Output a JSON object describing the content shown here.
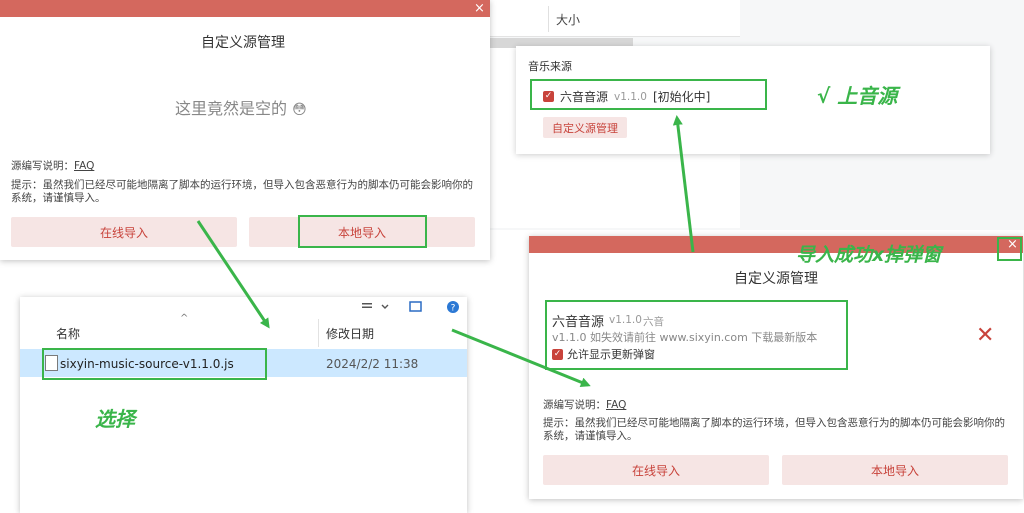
{
  "background": {
    "size_column": "大小"
  },
  "dialog1": {
    "title": "自定义源管理",
    "empty_text": "这里竟然是空的",
    "empty_emoji": "😳",
    "author_label": "源编写说明：",
    "faq": "FAQ",
    "hint": "提示：虽然我们已经尽可能地隔离了脚本的运行环境，但导入包含恶意行为的脚本仍可能会影响你的系统，请谨慎导入。",
    "online_import": "在线导入",
    "local_import": "本地导入",
    "close": "×"
  },
  "source_panel": {
    "label": "音乐来源",
    "source_name": "六音音源",
    "source_version": "v1.1.0",
    "source_status": "[初始化中]",
    "manage_button": "自定义源管理",
    "check": "✓"
  },
  "explorer": {
    "col_name": "名称",
    "col_date": "修改日期",
    "sort_icon": "^",
    "file_name": "sixyin-music-source-v1.1.0.js",
    "file_date": "2024/2/2 11:38"
  },
  "dialog2": {
    "title": "自定义源管理",
    "source_name": "六音音源",
    "source_version": "v1.1.0",
    "source_author": "六音",
    "source_desc": "v1.1.0 如失效请前往 www.sixyin.com 下载最新版本",
    "allow_update": "允许显示更新弹窗",
    "author_label": "源编写说明：",
    "faq": "FAQ",
    "hint": "提示：虽然我们已经尽可能地隔离了脚本的运行环境，但导入包含恶意行为的脚本仍可能会影响你的系统，请谨慎导入。",
    "online_import": "在线导入",
    "local_import": "本地导入",
    "close": "×",
    "delete": "✕"
  },
  "annotations": {
    "select": "选择",
    "source_ok": "√ 上音源",
    "import_success": "导入成功x掉弹窗"
  },
  "colors": {
    "accent": "#d4685e",
    "button_bg": "#f6e5e4",
    "button_text": "#c8433b",
    "annotation": "#3ab54a",
    "selected_row": "#cce8ff"
  }
}
